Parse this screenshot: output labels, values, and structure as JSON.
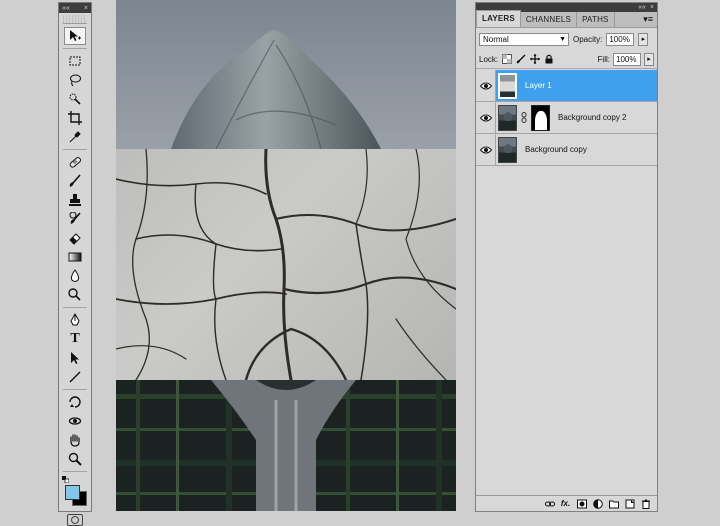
{
  "tools_panel": {
    "collapse_glyph": "««",
    "close_glyph": "×",
    "tools": [
      {
        "name": "move-tool-icon",
        "active": true
      },
      {
        "name": "marquee-tool-icon"
      },
      {
        "name": "lasso-tool-icon"
      },
      {
        "name": "quick-select-tool-icon"
      },
      {
        "name": "crop-tool-icon"
      },
      {
        "name": "eyedropper-tool-icon"
      },
      {
        "name": "healing-brush-tool-icon"
      },
      {
        "name": "brush-tool-icon"
      },
      {
        "name": "clone-stamp-tool-icon"
      },
      {
        "name": "history-brush-tool-icon"
      },
      {
        "name": "eraser-tool-icon"
      },
      {
        "name": "gradient-tool-icon"
      },
      {
        "name": "blur-tool-icon"
      },
      {
        "name": "dodge-tool-icon"
      },
      {
        "name": "pen-tool-icon"
      },
      {
        "name": "type-tool-icon",
        "glyph": "T"
      },
      {
        "name": "path-select-tool-icon"
      },
      {
        "name": "line-tool-icon"
      },
      {
        "name": "3d-rotate-tool-icon"
      },
      {
        "name": "3d-orbit-tool-icon"
      },
      {
        "name": "hand-tool-icon"
      },
      {
        "name": "zoom-tool-icon"
      }
    ],
    "foreground_color": "#7fc8ec",
    "background_color": "#000000"
  },
  "layers_panel": {
    "collapse_glyph": "««",
    "close_glyph": "×",
    "tabs": [
      {
        "label": "LAYERS",
        "active": true
      },
      {
        "label": "CHANNELS"
      },
      {
        "label": "PATHS"
      }
    ],
    "menu_glyph": "▾≡",
    "blend_mode": "Normal",
    "opacity_label": "Opacity:",
    "opacity_value": "100%",
    "lock_label": "Lock:",
    "fill_label": "Fill:",
    "fill_value": "100%",
    "layers": [
      {
        "name": "Layer 1",
        "selected": true,
        "visible": true,
        "has_mask": false
      },
      {
        "name": "Background copy 2",
        "selected": false,
        "visible": true,
        "has_mask": true
      },
      {
        "name": "Background copy",
        "selected": false,
        "visible": true,
        "has_mask": false
      }
    ],
    "footer_icons": [
      "link-layers-icon",
      "fx-icon",
      "add-mask-icon",
      "adjustment-layer-icon",
      "new-group-icon",
      "new-layer-icon",
      "trash-icon"
    ],
    "fx_label": "fx."
  },
  "colors": {
    "selection": "#3ea0ef",
    "panel_bg": "#d8d8d8",
    "workspace_bg": "#cfcfcf"
  }
}
